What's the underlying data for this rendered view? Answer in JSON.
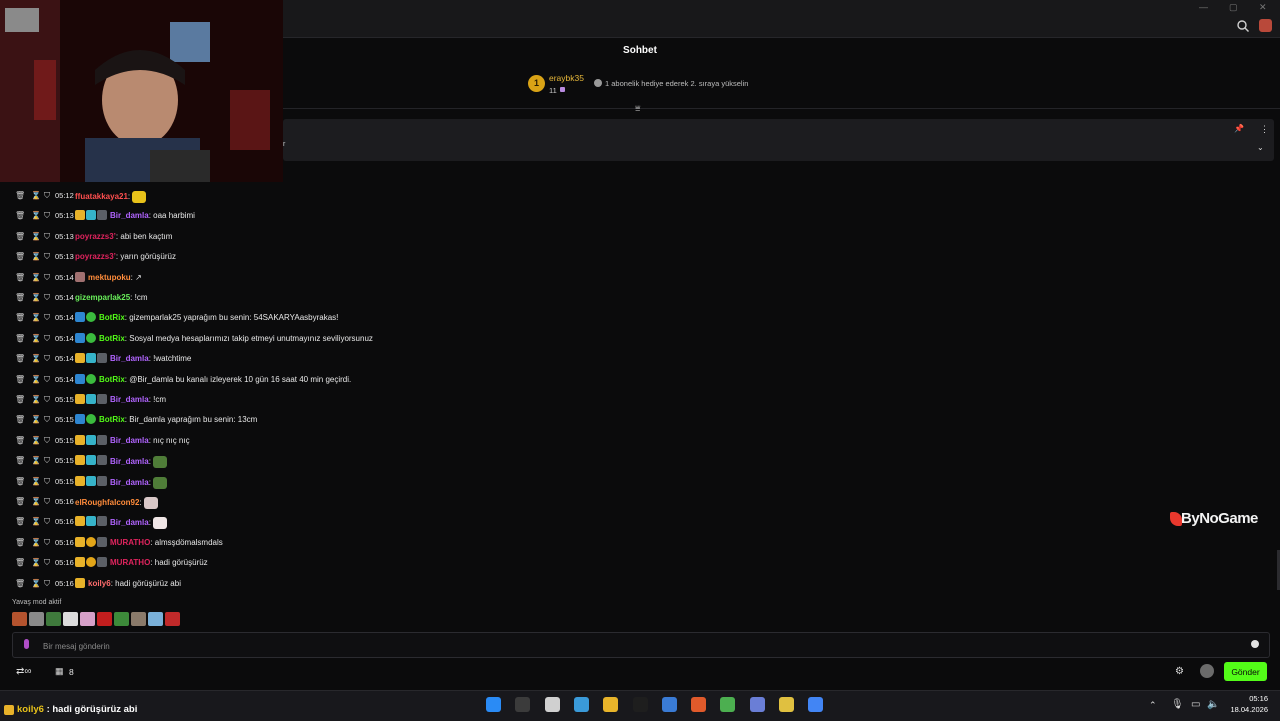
{
  "window": {
    "title": "Sohbet",
    "minimize": "—",
    "maximize": "▢",
    "close": "✕"
  },
  "gift_leader": {
    "rank": "1",
    "user": "eraybk35",
    "count": "11",
    "hint": "1 abonelik hediye ederek 2. sıraya yükselin"
  },
  "pinned": {
    "text_tail": "r"
  },
  "chat": {
    "rows": [
      {
        "time": "05:12",
        "badges": [],
        "user": "ffuatakkaya21",
        "user_color": "#ff4f4f",
        "sep": ":",
        "text": "",
        "emote": "#e8c21a"
      },
      {
        "time": "05:13",
        "badges": [
          "crown",
          "sub",
          "person"
        ],
        "user": "Bir_damla",
        "user_color": "#b164ff",
        "sep": ":",
        "text": " oaa harbimi",
        "emote": ""
      },
      {
        "time": "05:13",
        "badges": [],
        "user": "poyrazzs3’",
        "user_color": "#e0245e",
        "sep": ":",
        "text": " abi ben kaçtım",
        "emote": ""
      },
      {
        "time": "05:13",
        "badges": [],
        "user": "poyrazzs3’",
        "user_color": "#e0245e",
        "sep": ":",
        "text": " yarın görüşürüz",
        "emote": ""
      },
      {
        "time": "05:14",
        "badges": [
          "avatar"
        ],
        "user": "mektupoku",
        "user_color": "#ff8c3b",
        "sep": ":",
        "text": " ↗",
        "emote": ""
      },
      {
        "time": "05:14",
        "badges": [],
        "user": "gizemparlak25",
        "user_color": "#69f05a",
        "sep": ":",
        "text": " !cm",
        "emote": ""
      },
      {
        "time": "05:14",
        "badges": [
          "bot",
          "verified"
        ],
        "user": "BotRix",
        "user_color": "#53fc18",
        "sep": ":",
        "text": " gizemparlak25 yaprağım bu senin: 54SAKARYAasbyrakas!",
        "emote": ""
      },
      {
        "time": "05:14",
        "badges": [
          "bot",
          "verified"
        ],
        "user": "BotRix",
        "user_color": "#53fc18",
        "sep": ":",
        "text": " Sosyal medya hesaplarımızı takip etmeyi unutmayınız seviliyorsunuz",
        "emote": ""
      },
      {
        "time": "05:14",
        "badges": [
          "crown",
          "sub",
          "person"
        ],
        "user": "Bir_damla",
        "user_color": "#b164ff",
        "sep": ":",
        "text": " !watchtime",
        "emote": ""
      },
      {
        "time": "05:14",
        "badges": [
          "bot",
          "verified"
        ],
        "user": "BotRix",
        "user_color": "#53fc18",
        "sep": ":",
        "text": " @Bir_damla bu kanalı izleyerek 10 gün 16 saat 40 min geçirdi.",
        "emote": ""
      },
      {
        "time": "05:15",
        "badges": [
          "crown",
          "sub",
          "person"
        ],
        "user": "Bir_damla",
        "user_color": "#b164ff",
        "sep": ":",
        "text": " !cm",
        "emote": ""
      },
      {
        "time": "05:15",
        "badges": [
          "bot",
          "verified"
        ],
        "user": "BotRix",
        "user_color": "#53fc18",
        "sep": ":",
        "text": " Bir_damla yaprağım bu senin: 13cm",
        "emote": ""
      },
      {
        "time": "05:15",
        "badges": [
          "crown",
          "sub",
          "person"
        ],
        "user": "Bir_damla",
        "user_color": "#b164ff",
        "sep": ":",
        "text": " nıç nıç nıç",
        "emote": ""
      },
      {
        "time": "05:15",
        "badges": [
          "crown",
          "sub",
          "person"
        ],
        "user": "Bir_damla",
        "user_color": "#b164ff",
        "sep": ":",
        "text": "",
        "emote": "#4f7d38"
      },
      {
        "time": "05:15",
        "badges": [
          "crown",
          "sub",
          "person"
        ],
        "user": "Bir_damla",
        "user_color": "#b164ff",
        "sep": ":",
        "text": "",
        "emote": "#4f7d38"
      },
      {
        "time": "05:16",
        "badges": [],
        "user": "elRoughfalcon92",
        "user_color": "#ff8c3b",
        "sep": ":",
        "text": "",
        "emote": "#d9c8c8"
      },
      {
        "time": "05:16",
        "badges": [
          "crown",
          "sub",
          "person"
        ],
        "user": "Bir_damla",
        "user_color": "#b164ff",
        "sep": ":",
        "text": "",
        "emote": "#f0e6e6"
      },
      {
        "time": "05:16",
        "badges": [
          "crown",
          "coin",
          "person"
        ],
        "user": "MURATHO",
        "user_color": "#e0245e",
        "sep": ":",
        "text": " almsşdömalsmdals",
        "emote": ""
      },
      {
        "time": "05:16",
        "badges": [
          "crown",
          "coin",
          "person"
        ],
        "user": "MURATHO",
        "user_color": "#e0245e",
        "sep": ":",
        "text": " hadi görüşürüz",
        "emote": ""
      },
      {
        "time": "05:16",
        "badges": [
          "crown"
        ],
        "user": "koily6",
        "user_color": "#ff6d6d",
        "sep": ":",
        "text": " hadi görüşürüz abi",
        "emote": ""
      }
    ]
  },
  "slow_mode": "Yavaş mod aktif",
  "emotes": [
    "#b4532e",
    "#8a8a8a",
    "#3f7a3c",
    "#dcdcdc",
    "#d6a0c8",
    "#c21e1e",
    "#3d8a3a",
    "#8a7a6a",
    "#7ab0d8",
    "#c02a2a"
  ],
  "input": {
    "placeholder": "Bir mesaj gönderin",
    "value": ""
  },
  "footer": {
    "share_icon": "share-icon",
    "points": "8",
    "send_label": "Gönder"
  },
  "watermark": "ByNoGame",
  "ticker": {
    "user": "koily6",
    "text": " : hadi görüşürüz abi"
  },
  "taskbar": {
    "icons": [
      "#2a8bf5",
      "#3b3b3b",
      "#d0d0d0",
      "#3a9ad9",
      "#e8b42a",
      "#1e1e1e",
      "#3a7bd5",
      "#e05a2b",
      "#4caf50",
      "#6a7ed6",
      "#e0c040",
      "#4285f4"
    ],
    "time": "05:16",
    "date": "18.04.2026"
  },
  "colors": {
    "accent": "#53fc18",
    "background": "#0b0b0c"
  }
}
